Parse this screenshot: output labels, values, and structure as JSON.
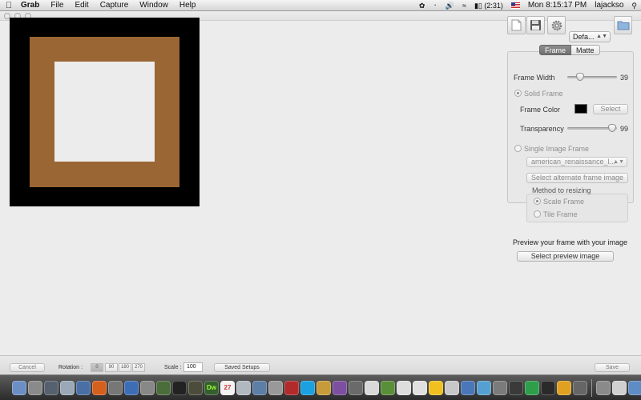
{
  "menubar": {
    "apple": "",
    "app_name": "Grab",
    "menus": [
      "File",
      "Edit",
      "Capture",
      "Window",
      "Help"
    ],
    "battery": "(2:31)",
    "clock": "Mon 8:15:17 PM",
    "user": "lajackso"
  },
  "toolbar": {
    "preset_value": "Defa..."
  },
  "tabs": {
    "frame": "Frame",
    "matte": "Matte"
  },
  "frame": {
    "frame_width_label": "Frame Width",
    "frame_width_value": "39",
    "frame_width_level": 0.22,
    "solid_frame_label": "Solid Frame",
    "frame_color_label": "Frame Color",
    "frame_color": "#000000",
    "select_label": "Select",
    "transparency_label": "Transparency",
    "transparency_value": "99",
    "transparency_level": 0.99,
    "single_image_label": "Single Image Frame",
    "image_select_value": "american_renaissance_l...",
    "select_alt_label": "Select alternate frame image",
    "method_label": "Method to resizing",
    "scale_frame_label": "Scale Frame",
    "tile_frame_label": "Tile Frame"
  },
  "preview": {
    "heading": "Preview your frame with your image",
    "select_preview_label": "Select preview image",
    "outer_color": "#000000",
    "frame_color": "#9a6633"
  },
  "bottombar": {
    "cancel_label": "Cancel",
    "rotation_label": "Rotation :",
    "rotations": [
      "0",
      "90",
      "180",
      "270"
    ],
    "scale_label": "Scale :",
    "scale_value": "100",
    "saved_setups_label": "Saved Setups",
    "save_label": "Save"
  },
  "dock": {
    "dreamweaver": "Dw",
    "calendar": "27"
  }
}
